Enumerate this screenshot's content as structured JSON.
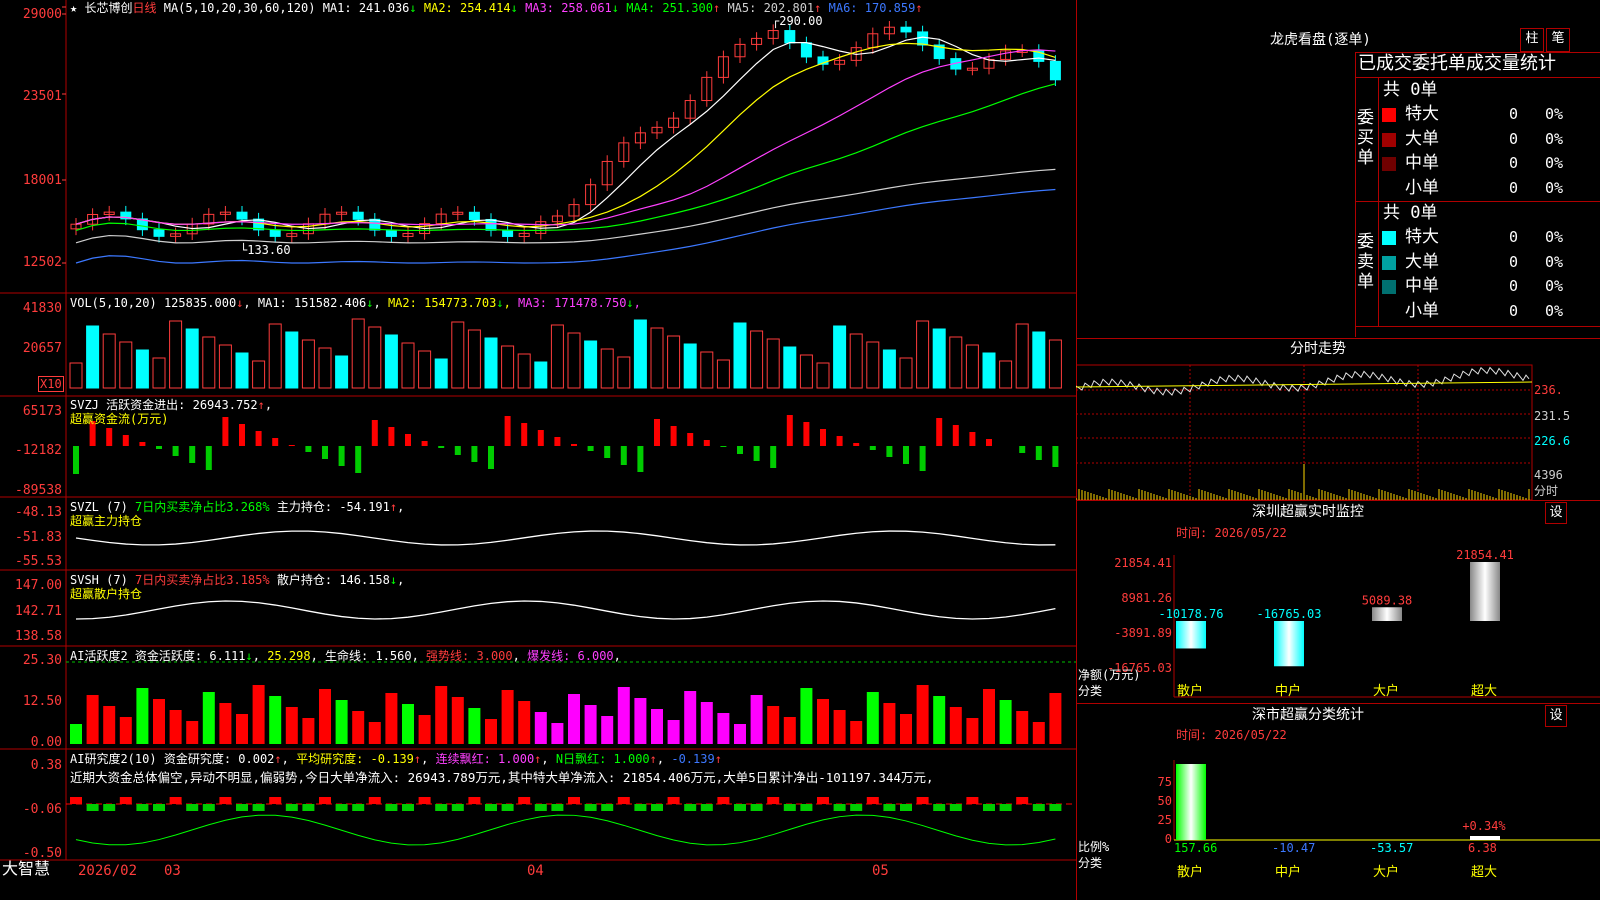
{
  "stock": {
    "name": "长芯博创",
    "period": "日线",
    "star": "★"
  },
  "main_chart": {
    "ma_params": "MA(5,10,20,30,60,120)",
    "ma": [
      {
        "label": "MA1:",
        "value": "241.036",
        "arrow": "↓",
        "color": "#ffffff"
      },
      {
        "label": "MA2:",
        "value": "254.414",
        "arrow": "↓",
        "color": "#ffff00"
      },
      {
        "label": "MA3:",
        "value": "258.061",
        "arrow": "↓",
        "color": "#ff40ff"
      },
      {
        "label": "MA4:",
        "value": "251.300",
        "arrow": "↑",
        "color": "#00ff00"
      },
      {
        "label": "MA5:",
        "value": "202.801",
        "arrow": "↑",
        "color": "#cfcfcf"
      },
      {
        "label": "MA6:",
        "value": "170.859",
        "arrow": "↑",
        "color": "#3c78ff"
      }
    ],
    "y_ticks": [
      "29000",
      "23501",
      "18001",
      "12502"
    ],
    "high_mark": "290.00",
    "low_mark": "133.60"
  },
  "vol": {
    "title": "VOL(5,10,20)",
    "value": "125835.000",
    "ma": [
      {
        "label": "MA1:",
        "value": "151582.406",
        "arrow": "↓",
        "color": "#ffffff"
      },
      {
        "label": "MA2:",
        "value": "154773.703",
        "arrow": "↓",
        "color": "#ffff00"
      },
      {
        "label": "MA3:",
        "value": "171478.750",
        "arrow": "↓",
        "color": "#ff40ff"
      }
    ],
    "y_ticks": [
      "41830",
      "20657"
    ],
    "unit": "X10"
  },
  "svzj": {
    "name": "SVZJ",
    "label": "活跃资金进出:",
    "value": "26943.752",
    "arrow": "↑",
    "sub": "超赢资金流(万元)",
    "y_ticks": [
      "65173",
      "-12182",
      "-89538"
    ]
  },
  "svzl": {
    "name": "SVZL (7)",
    "desc": "7日内买卖净占比3.268%",
    "label": "主力持仓:",
    "value": "-54.191",
    "arrow": "↑",
    "sub": "超赢主力持仓",
    "y_ticks": [
      "-48.13",
      "-51.83",
      "-55.53"
    ]
  },
  "svsh": {
    "name": "SVSH (7)",
    "desc": "7日内买卖净占比3.185%",
    "label": "散户持仓:",
    "value": "146.158",
    "arrow": "↓",
    "sub": "超赢散户持仓",
    "y_ticks": [
      "147.00",
      "142.71",
      "138.58"
    ]
  },
  "ai_active": {
    "name": "AI活跃度2",
    "label": "资金活跃度:",
    "value": "6.111",
    "arrow": "↓",
    "v2": "25.298",
    "life": "生命线: 1.560",
    "strong": "强势线: 3.000",
    "burst": "爆发线: 6.000",
    "y_ticks": [
      "25.30",
      "12.50",
      "0.00"
    ]
  },
  "ai_research": {
    "name": "AI研究度2(10)",
    "label": "资金研究度:",
    "value": "0.002",
    "arrow": "↑",
    "avg": "平均研究度: -0.139",
    "avg_arrow": "↑",
    "lianxu": "连续飘红: 1.000",
    "lianxu_arrow": "↑",
    "nday": "N日飘红: 1.000",
    "nday_arrow": "↑",
    "last": "-0.139",
    "last_arrow": "↑",
    "comment": "近期大资金总体偏空,异动不明显,偏弱势,今日大单净流入: 26943.789万元,其中特大单净流入: 21854.406万元,大单5日累计净出-101197.344万元,",
    "y_ticks": [
      "0.38",
      "-0.06",
      "-0.50"
    ]
  },
  "x_axis": {
    "brand": "大智慧",
    "labels": [
      "2026/02",
      "03",
      "04",
      "05"
    ]
  },
  "longhu": {
    "title": "龙虎看盘(逐单)",
    "btn_zhu": "柱",
    "btn_bi": "笔",
    "subtitle": "已成交委托单成交量统计",
    "buy": {
      "side": "委买单",
      "total": "共 0单",
      "rows": [
        {
          "name": "特大",
          "count": "0",
          "pct": "0%",
          "color": "#ff0000"
        },
        {
          "name": "大单",
          "count": "0",
          "pct": "0%",
          "color": "#a00000"
        },
        {
          "name": "中单",
          "count": "0",
          "pct": "0%",
          "color": "#700000"
        },
        {
          "name": "小单",
          "count": "0",
          "pct": "0%",
          "color": ""
        }
      ]
    },
    "sell": {
      "side": "委卖单",
      "total": "共 0单",
      "rows": [
        {
          "name": "特大",
          "count": "0",
          "pct": "0%",
          "color": "#00ffff"
        },
        {
          "name": "大单",
          "count": "0",
          "pct": "0%",
          "color": "#00a0a0"
        },
        {
          "name": "中单",
          "count": "0",
          "pct": "0%",
          "color": "#007070"
        },
        {
          "name": "小单",
          "count": "0",
          "pct": "0%",
          "color": ""
        }
      ]
    }
  },
  "intraday": {
    "title": "分时走势",
    "y_ticks": [
      "236.",
      "231.5",
      "226.6"
    ],
    "vol_tick": "4396",
    "vol_unit": "分时"
  },
  "monitor": {
    "title": "深圳超赢实时监控",
    "btn": "设",
    "time": "时间: 2026/05/22",
    "y_ticks": [
      "21854.41",
      "8981.26",
      "-3891.89",
      "-16765.03"
    ],
    "ylabel": "净额(万元)",
    "xlabel": "分类",
    "categories": [
      "散户",
      "中户",
      "大户",
      "超大"
    ],
    "values": [
      "-10178.76",
      "-16765.03",
      "5089.38",
      "21854.41"
    ]
  },
  "stats": {
    "title": "深市超赢分类统计",
    "btn": "设",
    "time": "时间: 2026/05/22",
    "y_ticks": [
      "75",
      "50",
      "25",
      "0"
    ],
    "ylabel": "比例%",
    "xlabel": "分类",
    "categories": [
      "散户",
      "中户",
      "大户",
      "超大"
    ],
    "values": [
      "157.66",
      "-10.47",
      "-53.57",
      "6.38"
    ],
    "annotation": "+0.34%"
  }
}
